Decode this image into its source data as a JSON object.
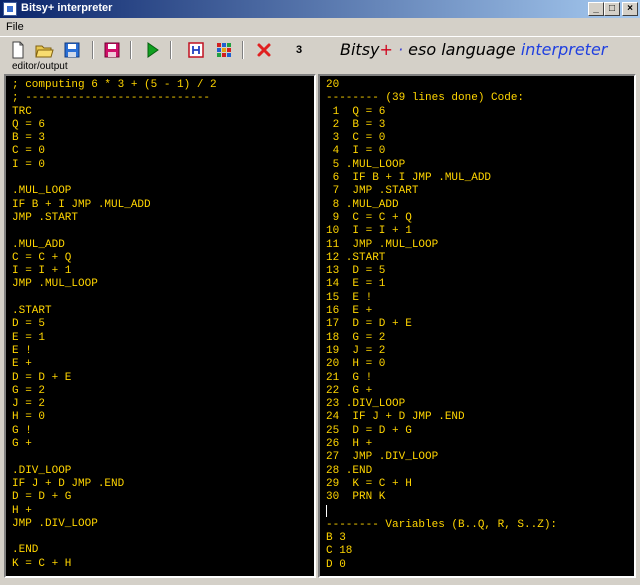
{
  "window": {
    "title": "Bitsy+ interpreter",
    "min_label": "_",
    "max_label": "□",
    "close_label": "×"
  },
  "menu": {
    "file_label": "File"
  },
  "toolbar": {
    "counter": "3",
    "brand_bitsy": "Bitsy",
    "brand_plus": "+",
    "brand_dot": " · ",
    "brand_eso": "eso language ",
    "brand_interpreter": "interpreter"
  },
  "group_label": "editor/output",
  "editor": {
    "lines": [
      "; computing 6 * 3 + (5 - 1) / 2",
      "; ----------------------------",
      "TRC",
      "Q = 6",
      "B = 3",
      "C = 0",
      "I = 0",
      "",
      ".MUL_LOOP",
      "IF B + I JMP .MUL_ADD",
      "JMP .START",
      "",
      ".MUL_ADD",
      "C = C + Q",
      "I = I + 1",
      "JMP .MUL_LOOP",
      "",
      ".START",
      "D = 5",
      "E = 1",
      "E !",
      "E +",
      "D = D + E",
      "G = 2",
      "J = 2",
      "H = 0",
      "G !",
      "G +",
      "",
      ".DIV_LOOP",
      "IF J + D JMP .END",
      "D = D + G",
      "H +",
      "JMP .DIV_LOOP",
      "",
      ".END",
      "K = C + H"
    ]
  },
  "output": {
    "lines": [
      "20",
      "-------- (39 lines done) Code:",
      " 1  Q = 6",
      " 2  B = 3",
      " 3  C = 0",
      " 4  I = 0",
      " 5 .MUL_LOOP",
      " 6  IF B + I JMP .MUL_ADD",
      " 7  JMP .START",
      " 8 .MUL_ADD",
      " 9  C = C + Q",
      "10  I = I + 1",
      "11  JMP .MUL_LOOP",
      "12 .START",
      "13  D = 5",
      "14  E = 1",
      "15  E !",
      "16  E +",
      "17  D = D + E",
      "18  G = 2",
      "19  J = 2",
      "20  H = 0",
      "21  G !",
      "22  G +",
      "23 .DIV_LOOP",
      "24  IF J + D JMP .END",
      "25  D = D + G",
      "26  H +",
      "27  JMP .DIV_LOOP",
      "28 .END",
      "29  K = C + H",
      "30  PRN K"
    ],
    "vars_header": "-------- Variables (B..Q, R, S..Z):",
    "vars": [
      "B 3",
      "C 18",
      "D 0"
    ]
  },
  "colors": {
    "text": "#ffd500",
    "bg": "#000000",
    "titlebar": "#0a246a"
  },
  "icons": [
    "new-file-icon",
    "open-folder-icon",
    "save-icon",
    "save-as-icon",
    "run-icon",
    "help-icon",
    "palette-icon",
    "clear-icon"
  ]
}
